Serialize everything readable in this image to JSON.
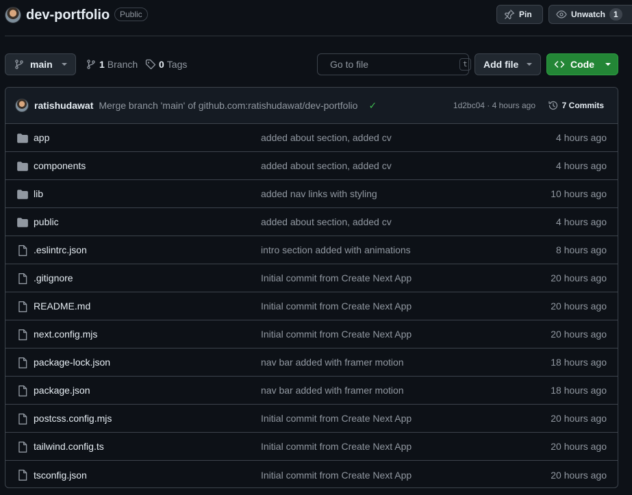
{
  "repo": {
    "name": "dev-portfolio",
    "visibility": "Public"
  },
  "header": {
    "pin_label": "Pin",
    "unwatch_label": "Unwatch",
    "watch_count": "1"
  },
  "toolbar": {
    "branch": "main",
    "branch_count": "1",
    "branch_label": "Branch",
    "tag_count": "0",
    "tag_label": "Tags",
    "search_placeholder": "Go to file",
    "search_shortcut": "t",
    "add_file_label": "Add file",
    "code_label": "Code"
  },
  "latest_commit": {
    "author": "ratishudawat",
    "message": "Merge branch 'main' of github.com:ratishudawat/dev-portfolio",
    "hash_time": "1d2bc04 · 4 hours ago",
    "commits_label": "7 Commits"
  },
  "files": [
    {
      "type": "folder",
      "name": "app",
      "message": "added about section, added cv",
      "age": "4 hours ago"
    },
    {
      "type": "folder",
      "name": "components",
      "message": "added about section, added cv",
      "age": "4 hours ago"
    },
    {
      "type": "folder",
      "name": "lib",
      "message": "added nav links with styling",
      "age": "10 hours ago"
    },
    {
      "type": "folder",
      "name": "public",
      "message": "added about section, added cv",
      "age": "4 hours ago"
    },
    {
      "type": "file",
      "name": ".eslintrc.json",
      "message": "intro section added with animations",
      "age": "8 hours ago"
    },
    {
      "type": "file",
      "name": ".gitignore",
      "message": "Initial commit from Create Next App",
      "age": "20 hours ago"
    },
    {
      "type": "file",
      "name": "README.md",
      "message": "Initial commit from Create Next App",
      "age": "20 hours ago"
    },
    {
      "type": "file",
      "name": "next.config.mjs",
      "message": "Initial commit from Create Next App",
      "age": "20 hours ago"
    },
    {
      "type": "file",
      "name": "package-lock.json",
      "message": "nav bar added with framer motion",
      "age": "18 hours ago"
    },
    {
      "type": "file",
      "name": "package.json",
      "message": "nav bar added with framer motion",
      "age": "18 hours ago"
    },
    {
      "type": "file",
      "name": "postcss.config.mjs",
      "message": "Initial commit from Create Next App",
      "age": "20 hours ago"
    },
    {
      "type": "file",
      "name": "tailwind.config.ts",
      "message": "Initial commit from Create Next App",
      "age": "20 hours ago"
    },
    {
      "type": "file",
      "name": "tsconfig.json",
      "message": "Initial commit from Create Next App",
      "age": "20 hours ago"
    }
  ]
}
